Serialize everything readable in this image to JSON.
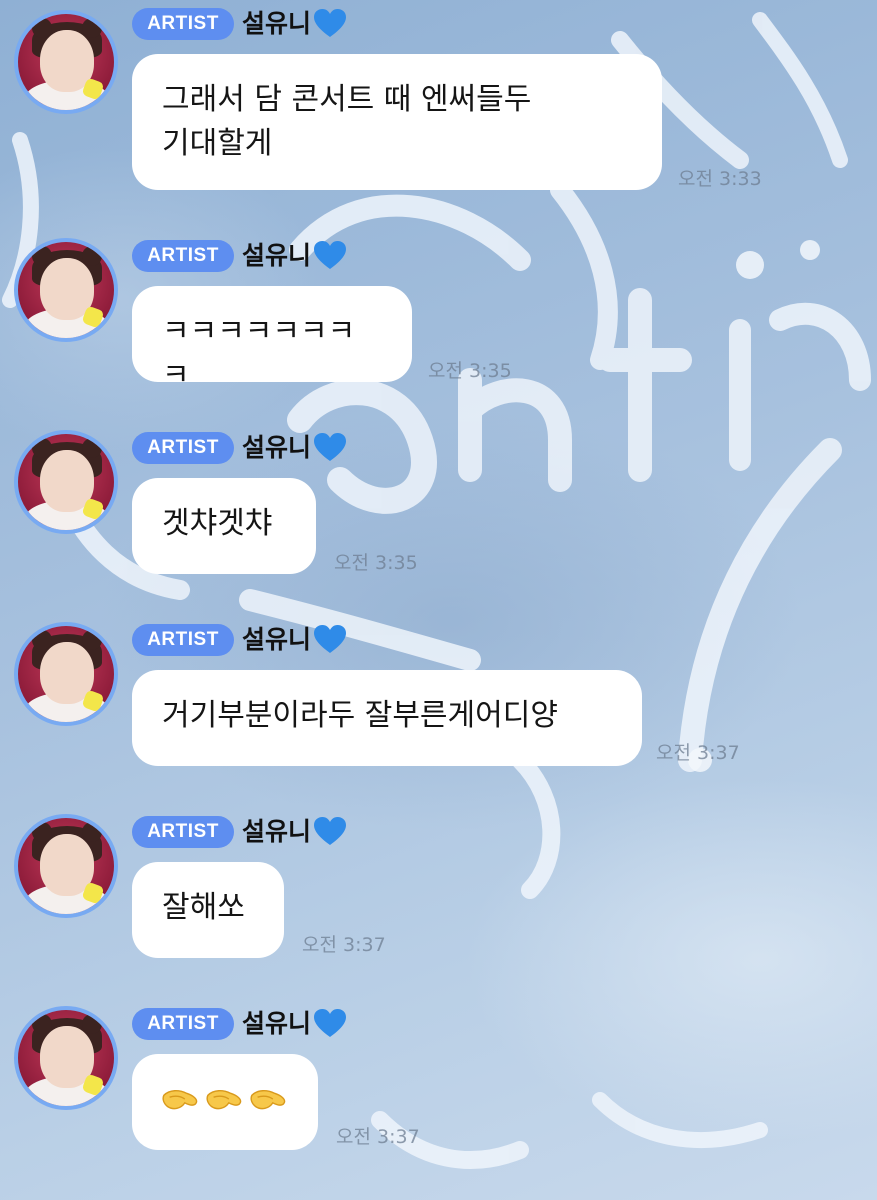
{
  "messages": [
    {
      "badge": "ARTIST",
      "sender": "설유니",
      "text_lines": [
        "그래서 담 콘서트 때 엔써들두",
        "기대할게"
      ],
      "time": "오전 3:33"
    },
    {
      "badge": "ARTIST",
      "sender": "설유니",
      "text_lines": [
        "ㅋㅋㅋㅋㅋㅋㅋㅋ"
      ],
      "time": "오전 3:35"
    },
    {
      "badge": "ARTIST",
      "sender": "설유니",
      "text_lines": [
        "겟챠겟챠"
      ],
      "time": "오전 3:35"
    },
    {
      "badge": "ARTIST",
      "sender": "설유니",
      "text_lines": [
        "거기부분이라두 잘부른게어디양"
      ],
      "time": "오전 3:37"
    },
    {
      "badge": "ARTIST",
      "sender": "설유니",
      "text_lines": [
        "잘해쏘"
      ],
      "time": "오전 3:37"
    },
    {
      "badge": "ARTIST",
      "sender": "설유니",
      "emoji": "pinching-hand-icon",
      "emoji_count": 3,
      "time": "오전 3:37"
    }
  ],
  "colors": {
    "badge": "#5e8ef0",
    "avatar_ring": "#78aaf2",
    "heart": "#2f8be8",
    "bubble": "#ffffff",
    "background": "#9fb9d6"
  },
  "icons": {
    "heart": "blue-heart-icon",
    "avatar": "artist-avatar-icon"
  }
}
